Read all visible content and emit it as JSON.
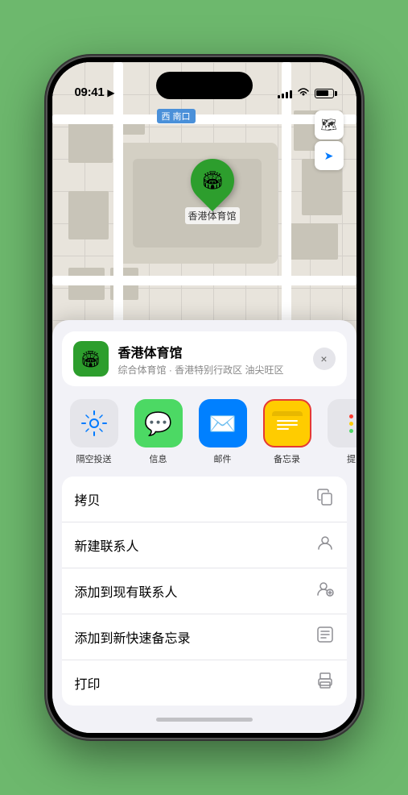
{
  "status_bar": {
    "time": "09:41",
    "location_arrow": "▶"
  },
  "map": {
    "road_label": "南口",
    "road_prefix": "西",
    "pin_label": "香港体育馆"
  },
  "location_card": {
    "name": "香港体育馆",
    "subtitle": "综合体育馆 · 香港特别行政区 油尖旺区",
    "close_label": "×"
  },
  "share_items": [
    {
      "id": "airdrop",
      "label": "隔空投送",
      "bg": "#f0f0f0",
      "icon": "📡"
    },
    {
      "id": "message",
      "label": "信息",
      "bg": "#4cd964",
      "icon": "💬"
    },
    {
      "id": "mail",
      "label": "邮件",
      "bg": "#0080ff",
      "icon": "✉️"
    },
    {
      "id": "notes",
      "label": "备忘录",
      "bg": "#ffcc00",
      "icon": "📝",
      "highlighted": true
    }
  ],
  "more_dots": {
    "colors": [
      "#ff3b30",
      "#ffcc00",
      "#4cd964"
    ]
  },
  "action_items": [
    {
      "label": "拷贝",
      "icon": "copy"
    },
    {
      "label": "新建联系人",
      "icon": "person"
    },
    {
      "label": "添加到现有联系人",
      "icon": "person-add"
    },
    {
      "label": "添加到新快速备忘录",
      "icon": "note"
    },
    {
      "label": "打印",
      "icon": "printer"
    }
  ],
  "map_controls": {
    "layers_icon": "🗺",
    "location_icon": "➤"
  }
}
